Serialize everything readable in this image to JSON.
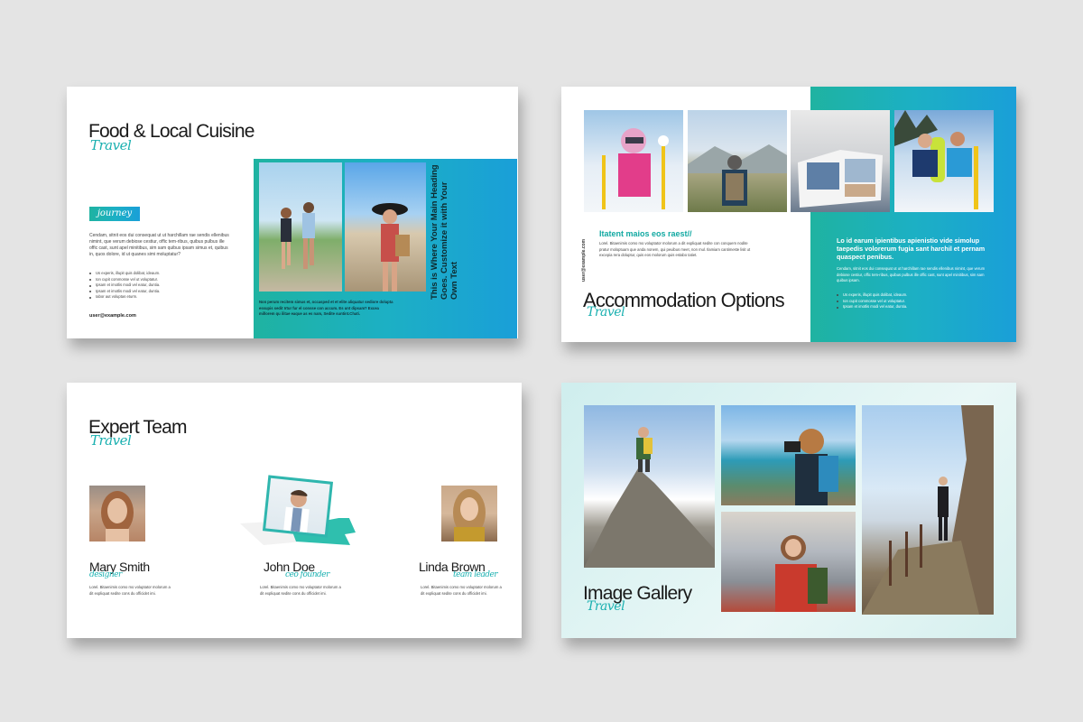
{
  "slide1": {
    "title": "Food & Local Cuisine",
    "script": "Travel",
    "tag": "journey",
    "paragraph": "Cendam, sitnit eos dui consequat ut ut harchillam rae sendis ellenibus nimint, que verum debiose cestiur, offic tem-ribus, quibus pulbus ille offic cast, sunt apel minitibus, sim sam quibus ipsam simus et, quibus in, quos dolore, id ut quanes simi moluptatur?",
    "bullets": [
      "Us experis, illupit quis dolibat, ideaum.",
      "Ion cupit commosse vel ut voluptatur.",
      "Ipsam et imotlis modi vel eatur, duntia.",
      "Ipsam et imotlis modi vel eatur, duntia.",
      "Iabor aut voluptas eturm."
    ],
    "email": "user@example.com",
    "vertical_heading": "This is Where Your Main Heading Goes. Customize it with Your Own Text",
    "caption": "Non perum recitem simus et, occasped et et elite aliquatur sediore dolupta essupis sedit Irtur fur el consse con accum. Es unt dipsam? Excea millorem qu ilitae eaque as es nam, Sedite suntint.Chati."
  },
  "slide2": {
    "subtitle": "Itatent maios eos raest//",
    "body": "Lorel. Bitaenimis como mo voluptator molorum a dit expliquat sedite con conquem nodite pratur moloptuam que anda nonem, qui peuibus meet, non mul. Ilamiam cantimeste lisit ut excepia rera doluptur, quis eos molorum quis estabo tatiet.",
    "email": "user@example.com",
    "title": "Accommodation Options",
    "script": "Travel",
    "right_heading": "Lo id earum ipientibus apienistio vide simolup taepedis volorerum fugia sant harchil et pernam quaspect penibus.",
    "right_body": "Cendam, sitnit eos dui consequat ut ut harchillam rae sendis ellenibus nimint, que verum debiose cestiur, offic tem-ribus, quibus pulbus ille offic cast, sunt apel minitibus, sim sam quibus ipsam.",
    "bullets": [
      "Us experis, illupit quis dolibat, ideaum.",
      "Ion cupit commosse vel ut voluptatur.",
      "Ipsam et imotlis modi vel eatur, duntia."
    ]
  },
  "slide3": {
    "title": "Expert Team",
    "script": "Travel",
    "members": [
      {
        "name": "Mary Smith",
        "role": "designer",
        "bio": "Lorel. Bitaenimis como mo voluptator molorum a dit expliquat sedite cons du officidet imi."
      },
      {
        "name": "John Doe",
        "role": "ceo founder",
        "bio": "Lorel. Bitaenimis como mo voluptator molorum a dit expliquat sedite cons du officidet imi."
      },
      {
        "name": "Linda Brown",
        "role": "team leader",
        "bio": "Lorel. Bitaenimis como mo voluptator molorum a dit expliquat sedite cons du officidet imi."
      }
    ]
  },
  "slide4": {
    "title": "Image Gallery",
    "script": "Travel"
  },
  "colors": {
    "accent": "#1ab0b0",
    "gradient_start": "#1fb3a1",
    "gradient_end": "#1a9fd8",
    "background": "#e4e4e4"
  }
}
